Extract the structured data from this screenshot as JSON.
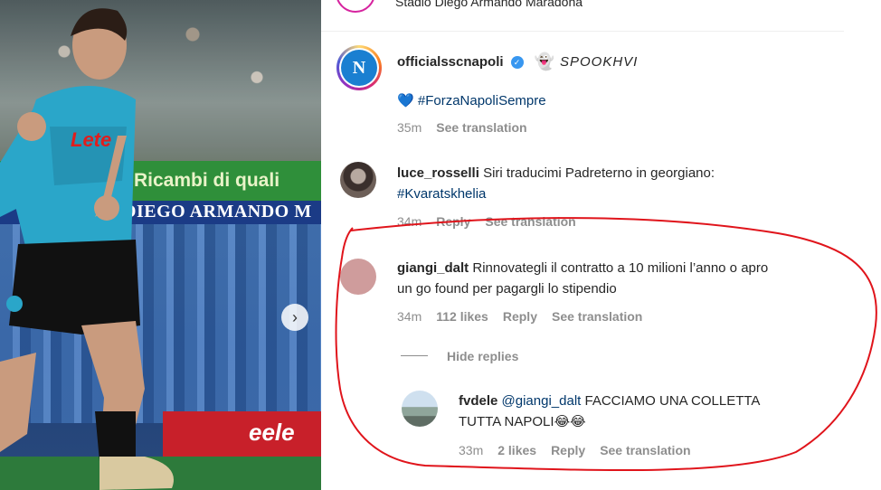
{
  "post": {
    "location": "Stadio Diego Armando Maradona",
    "photo": {
      "banner_green_text": "Ricambi di quali",
      "banner_blue_text": "DIEGO ARMANDO M",
      "adboard_text": "eele",
      "jersey_text": "Lete"
    }
  },
  "caption": {
    "username": "officialsscnapoli",
    "verified": true,
    "spook_emoji": "👻",
    "spook_text": "SPOOKHVI",
    "heart_emoji": "💙",
    "hashtag": "#ForzaNapoliSempre",
    "time": "35m",
    "translation_label": "See translation",
    "avatar_letter": "N"
  },
  "comments": [
    {
      "username": "luce_rosselli",
      "text": "Siri traducimi Padreterno in georgiano:",
      "hashtag": "#Kvaratskhelia",
      "time": "34m",
      "reply_label": "Reply",
      "translation_label": "See translation"
    },
    {
      "username": "giangi_dalt",
      "text_line1": "Rinnovategli il contratto a 10 milioni l’anno o apro",
      "text_line2": "un go found per pagargli lo stipendio",
      "time": "34m",
      "likes": "112 likes",
      "reply_label": "Reply",
      "translation_label": "See translation",
      "hide_replies_label": "Hide replies",
      "replies": [
        {
          "username": "fvdele",
          "mention": "@giangi_dalt",
          "text_line1": "FACCIAMO UNA COLLETTA",
          "text_line2": "TUTTA NAPOLI😂😂",
          "time": "33m",
          "likes": "2 likes",
          "reply_label": "Reply",
          "translation_label": "See translation"
        }
      ]
    }
  ],
  "colors": {
    "annotation": "#e0141b",
    "hashtag": "#00376b",
    "meta": "#8e8e8e",
    "verified": "#3897f0"
  },
  "icons": {
    "gallery_next": "chevron-right-icon",
    "verified": "verified-badge-icon"
  }
}
